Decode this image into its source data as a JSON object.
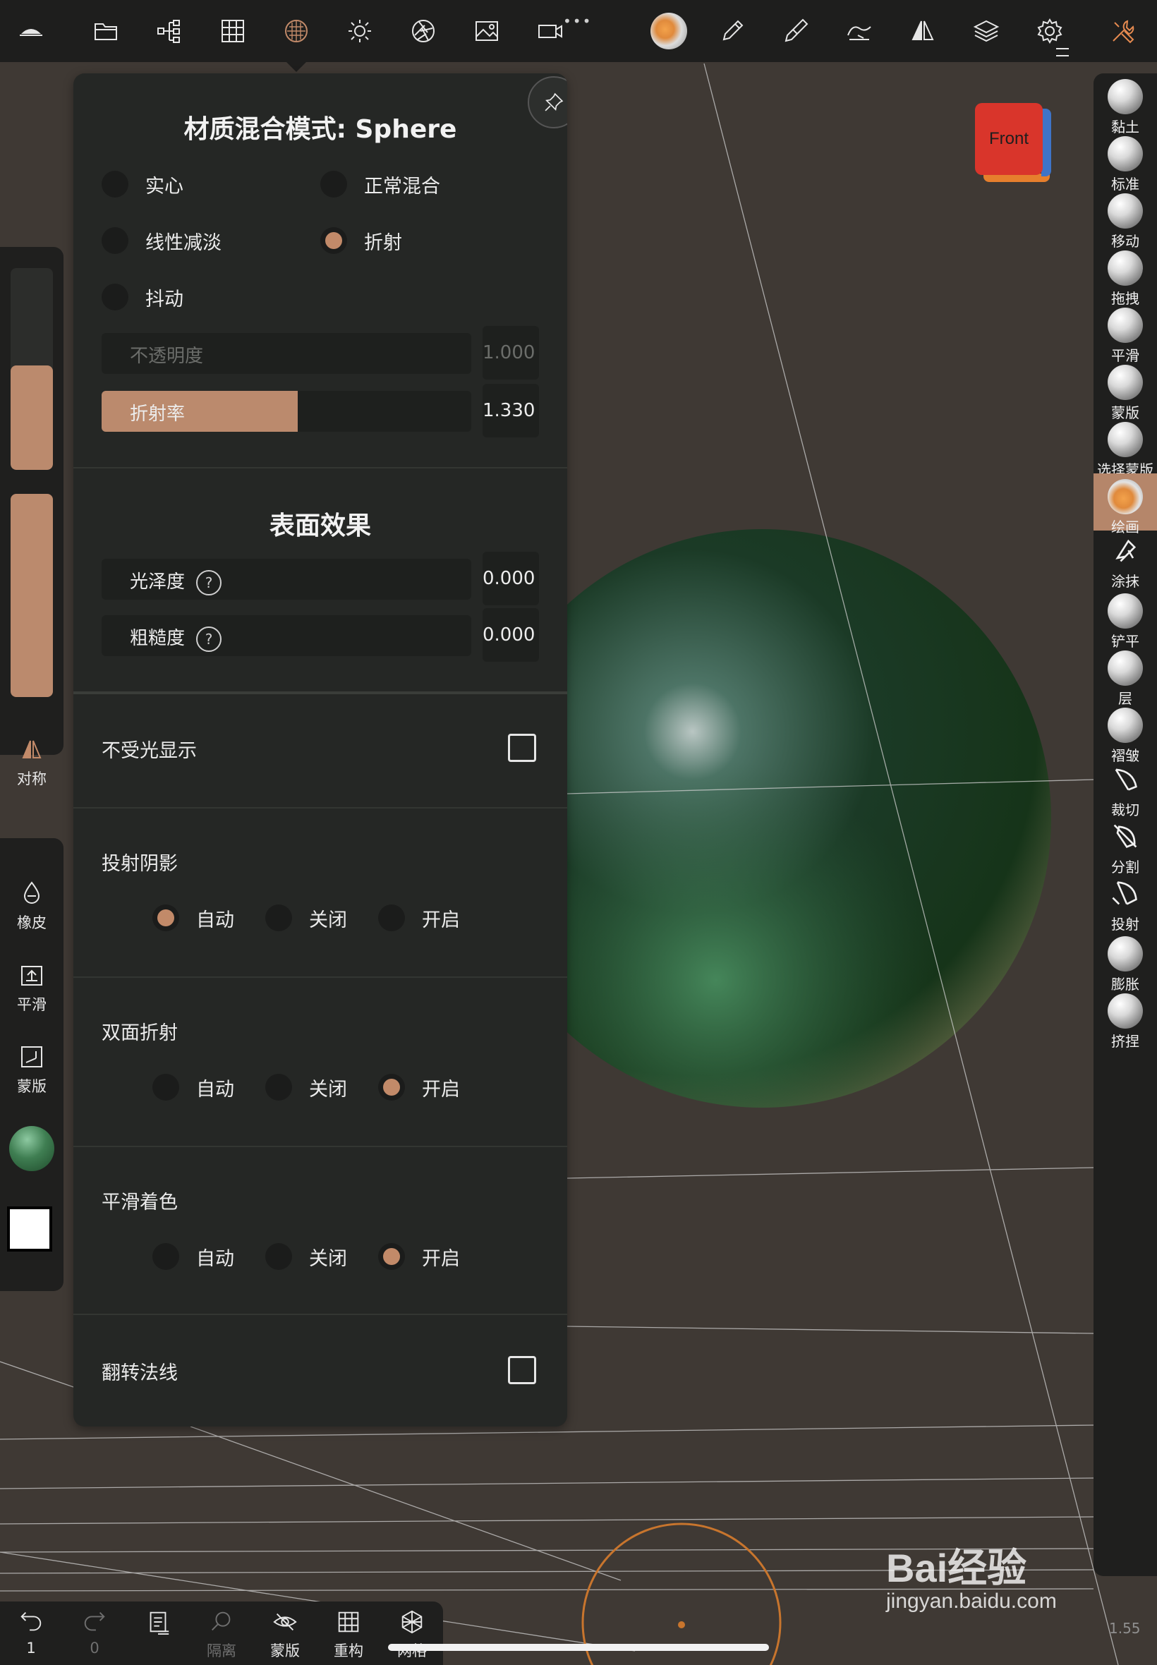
{
  "toolbar": {
    "icons": [
      "logo-icon",
      "folder-icon",
      "scene-tree-icon",
      "grid-icon",
      "material-icon",
      "light-icon",
      "camera-aperture-icon",
      "image-icon",
      "video-icon",
      "paint-ball-icon",
      "pen-icon",
      "brush-icon",
      "curve-icon",
      "mirror-icon",
      "layers-icon",
      "settings-icon",
      "tools-icon"
    ]
  },
  "material_panel": {
    "title": "材质混合模式: Sphere",
    "blend_modes": [
      {
        "label": "实心",
        "selected": false
      },
      {
        "label": "正常混合",
        "selected": false
      },
      {
        "label": "线性减淡",
        "selected": false
      },
      {
        "label": "折射",
        "selected": true
      },
      {
        "label": "抖动",
        "selected": false
      }
    ],
    "opacity": {
      "label": "不透明度",
      "value": "1.000",
      "enabled": false
    },
    "refraction": {
      "label": "折射率",
      "value": "1.330",
      "fill_fraction": 0.53
    },
    "surface": {
      "title": "表面效果",
      "gloss": {
        "label": "光泽度",
        "value": "0.000"
      },
      "roughness": {
        "label": "粗糙度",
        "value": "0.000"
      },
      "help_glyph": "?"
    },
    "unlit": {
      "label": "不受光显示",
      "checked": false
    },
    "cast_shadow": {
      "title": "投射阴影",
      "options": [
        "自动",
        "关闭",
        "开启"
      ],
      "selected": 0
    },
    "double_refraction": {
      "title": "双面折射",
      "options": [
        "自动",
        "关闭",
        "开启"
      ],
      "selected": 2
    },
    "smooth_shading": {
      "title": "平滑着色",
      "options": [
        "自动",
        "关闭",
        "开启"
      ],
      "selected": 2
    },
    "flip_normals": {
      "label": "翻转法线",
      "checked": false
    }
  },
  "left_sidebar": {
    "symmetry_label": "对称",
    "eraser_label": "橡皮",
    "smooth_label": "平滑",
    "mask_label": "蒙版",
    "color_accent": "#bb8a6d",
    "material_ball_color": "#3f7e52",
    "swatch_color": "#ffffff"
  },
  "right_tools": [
    {
      "label": "黏土",
      "kind": "ball"
    },
    {
      "label": "标准",
      "kind": "ball"
    },
    {
      "label": "移动",
      "kind": "ball"
    },
    {
      "label": "拖拽",
      "kind": "ball"
    },
    {
      "label": "平滑",
      "kind": "ball"
    },
    {
      "label": "蒙版",
      "kind": "ball"
    },
    {
      "label": "选择蒙版",
      "kind": "ball"
    },
    {
      "label": "绘画",
      "kind": "ball",
      "active": true
    },
    {
      "label": "涂抹",
      "kind": "glyph"
    },
    {
      "label": "铲平",
      "kind": "ball"
    },
    {
      "label": "层",
      "kind": "ball"
    },
    {
      "label": "褶皱",
      "kind": "ball"
    },
    {
      "label": "裁切",
      "kind": "glyph"
    },
    {
      "label": "分割",
      "kind": "glyph"
    },
    {
      "label": "投射",
      "kind": "glyph"
    },
    {
      "label": "膨胀",
      "kind": "ball"
    },
    {
      "label": "挤捏",
      "kind": "ball"
    }
  ],
  "view_cube": {
    "label": "Front",
    "color": "#d9352b"
  },
  "bottom_bar": {
    "undo_count": "1",
    "redo_count": "0",
    "items": [
      {
        "label": "隔离",
        "enabled": false
      },
      {
        "label": "蒙版",
        "enabled": true
      },
      {
        "label": "重构",
        "enabled": true
      },
      {
        "label": "网格",
        "enabled": true
      }
    ]
  },
  "brush_size_value": "1.55",
  "watermark": {
    "brand": "Bai经验",
    "url": "jingyan.baidu.com"
  }
}
